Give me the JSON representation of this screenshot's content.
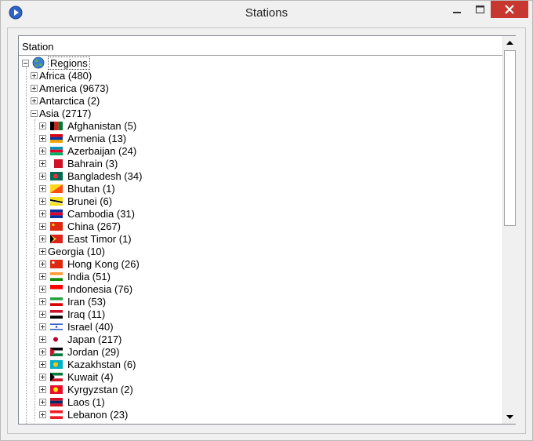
{
  "window": {
    "title": "Stations"
  },
  "list": {
    "column_header": "Station",
    "root": {
      "label": "Regions",
      "icon": "globe-icon"
    },
    "regions": [
      {
        "label": "Africa (480)",
        "expanded": false
      },
      {
        "label": "America (9673)",
        "expanded": false
      },
      {
        "label": "Antarctica (2)",
        "expanded": false
      },
      {
        "label": "Asia (2717)",
        "expanded": true
      }
    ],
    "countries": [
      {
        "label": "Afghanistan (5)",
        "flag": [
          "#000000",
          "#d32011",
          "#007a36"
        ],
        "orient": "v"
      },
      {
        "label": "Armenia (13)",
        "flag": [
          "#d90012",
          "#0033a0",
          "#f2a800"
        ],
        "orient": "h"
      },
      {
        "label": "Azerbaijan (24)",
        "flag": [
          "#0092bc",
          "#e4002b",
          "#00af66"
        ],
        "orient": "h"
      },
      {
        "label": "Bahrain (3)",
        "flag": [
          "#ffffff",
          "#ce1126"
        ],
        "orient": "v2"
      },
      {
        "label": "Bangladesh (34)",
        "flag": [
          "#006a4e",
          "#f42a41"
        ],
        "orient": "disc"
      },
      {
        "label": "Bhutan (1)",
        "flag": [
          "#ffd520",
          "#ff4e12"
        ],
        "orient": "diag"
      },
      {
        "label": "Brunei (6)",
        "flag": [
          "#f7e017",
          "#000000",
          "#ffffff"
        ],
        "orient": "diag2"
      },
      {
        "label": "Cambodia (31)",
        "flag": [
          "#032ea1",
          "#e00025",
          "#032ea1"
        ],
        "orient": "h"
      },
      {
        "label": "China (267)",
        "flag": [
          "#de2910",
          "#ffde00"
        ],
        "orient": "star"
      },
      {
        "label": "East Timor (1)",
        "flag": [
          "#dc241f",
          "#ffc726",
          "#000000"
        ],
        "orient": "tri"
      },
      {
        "label": "Georgia (10)",
        "flag": [],
        "orient": "none"
      },
      {
        "label": "Hong Kong (26)",
        "flag": [
          "#de2910",
          "#ffffff"
        ],
        "orient": "star"
      },
      {
        "label": "India (51)",
        "flag": [
          "#ff9933",
          "#ffffff",
          "#138808"
        ],
        "orient": "h"
      },
      {
        "label": "Indonesia (76)",
        "flag": [
          "#ff0000",
          "#ffffff"
        ],
        "orient": "h2"
      },
      {
        "label": "Iran (53)",
        "flag": [
          "#239f40",
          "#ffffff",
          "#da0000"
        ],
        "orient": "h"
      },
      {
        "label": "Iraq (11)",
        "flag": [
          "#ce1126",
          "#ffffff",
          "#000000"
        ],
        "orient": "h"
      },
      {
        "label": "Israel (40)",
        "flag": [
          "#ffffff",
          "#0038b8"
        ],
        "orient": "israel"
      },
      {
        "label": "Japan (217)",
        "flag": [
          "#ffffff",
          "#bc002d"
        ],
        "orient": "disc"
      },
      {
        "label": "Jordan (29)",
        "flag": [
          "#000000",
          "#ffffff",
          "#007a3d",
          "#ce1126"
        ],
        "orient": "tri"
      },
      {
        "label": "Kazakhstan (6)",
        "flag": [
          "#00afca",
          "#fec50c"
        ],
        "orient": "disc"
      },
      {
        "label": "Kuwait (4)",
        "flag": [
          "#007a3d",
          "#ffffff",
          "#ce1126",
          "#000000"
        ],
        "orient": "tri"
      },
      {
        "label": "Kyrgyzstan (2)",
        "flag": [
          "#e8112d",
          "#ffef00"
        ],
        "orient": "disc"
      },
      {
        "label": "Laos (1)",
        "flag": [
          "#ce1126",
          "#002868",
          "#ce1126"
        ],
        "orient": "h"
      },
      {
        "label": "Lebanon (23)",
        "flag": [
          "#ed1c24",
          "#ffffff",
          "#ed1c24"
        ],
        "orient": "h"
      }
    ]
  }
}
